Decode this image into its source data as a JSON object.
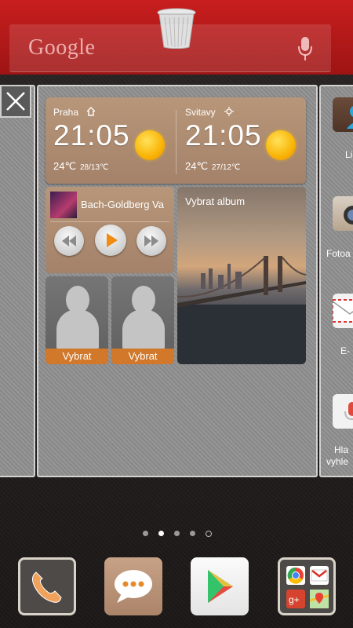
{
  "search": {
    "brand": "Google"
  },
  "weather": {
    "left": {
      "city": "Praha",
      "time": "21:05",
      "temp": "24℃",
      "range": "28/13℃"
    },
    "right": {
      "city": "Svitavy",
      "time": "21:05",
      "temp": "24℃",
      "range": "27/12℃"
    }
  },
  "music": {
    "track": "Bach-Goldberg Va"
  },
  "album": {
    "title": "Vybrat album"
  },
  "contacts": [
    {
      "label": "Vybrat"
    },
    {
      "label": "Vybrat"
    }
  ],
  "right_column": [
    {
      "label": "Li",
      "icon": "contacts-icon"
    },
    {
      "label": "Fotoa",
      "icon": "camera-icon"
    },
    {
      "label": "E-",
      "icon": "email-icon"
    },
    {
      "label": "Hla",
      "label2": "vyhle",
      "icon": "voice-search-icon"
    }
  ],
  "pages": {
    "count": 5,
    "active": 1
  },
  "dock": [
    {
      "name": "phone",
      "icon": "phone-icon"
    },
    {
      "name": "messaging",
      "icon": "message-icon"
    },
    {
      "name": "play-store",
      "icon": "play-store-icon"
    },
    {
      "name": "google-folder",
      "icon": "folder-icon"
    }
  ],
  "colors": {
    "delete_band": "#c81e1e",
    "widget": "#b79679",
    "contact_label": "#d1782b",
    "accent_orange": "#f9b406"
  }
}
